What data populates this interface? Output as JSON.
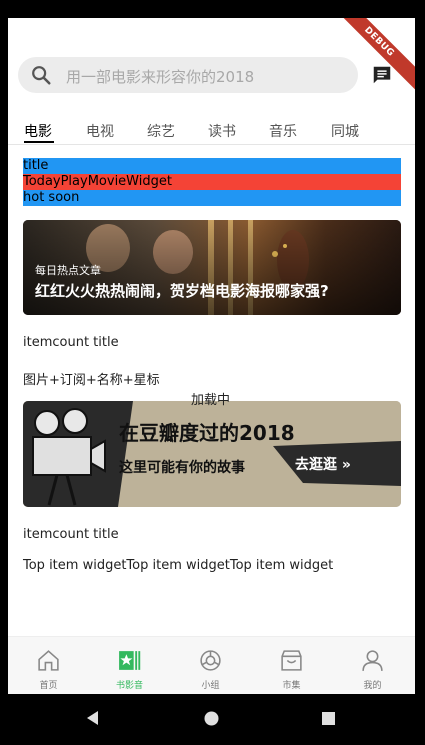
{
  "debug_banner": "DEBUG",
  "search": {
    "placeholder": "用一部电影来形容你的2018"
  },
  "tabs": [
    {
      "label": "电影",
      "active": true
    },
    {
      "label": "电视",
      "active": false
    },
    {
      "label": "综艺",
      "active": false
    },
    {
      "label": "读书",
      "active": false
    },
    {
      "label": "音乐",
      "active": false
    },
    {
      "label": "同城",
      "active": false
    }
  ],
  "bars": [
    {
      "text": "title",
      "color": "#2196f3"
    },
    {
      "text": "TodayPlayMovieWidget",
      "color": "#f44336"
    },
    {
      "text": "hot soon",
      "color": "#2196f3"
    }
  ],
  "banner": {
    "subtitle": "每日热点文章",
    "title": "红红火火热热闹闹，贺岁档电影海报哪家强?"
  },
  "section1": {
    "title": "itemcount title",
    "desc": "图片+订阅+名称+星标"
  },
  "loading": "加载中",
  "promo": {
    "line1": "在豆瓣度过的2018",
    "line2": "这里可能有你的故事",
    "cta": "去逛逛 »"
  },
  "section2": {
    "title": "itemcount title",
    "desc": "Top item widgetTop item widgetTop item widget"
  },
  "bottom_nav": [
    {
      "label": "首页",
      "icon": "home-icon",
      "active": false
    },
    {
      "label": "书影音",
      "icon": "star-board-icon",
      "active": true
    },
    {
      "label": "小组",
      "icon": "group-icon",
      "active": false
    },
    {
      "label": "市集",
      "icon": "shop-icon",
      "active": false
    },
    {
      "label": "我的",
      "icon": "person-icon",
      "active": false
    }
  ],
  "colors": {
    "accent": "#34b95f",
    "blue_bar": "#2196f3",
    "red_bar": "#f44336"
  }
}
